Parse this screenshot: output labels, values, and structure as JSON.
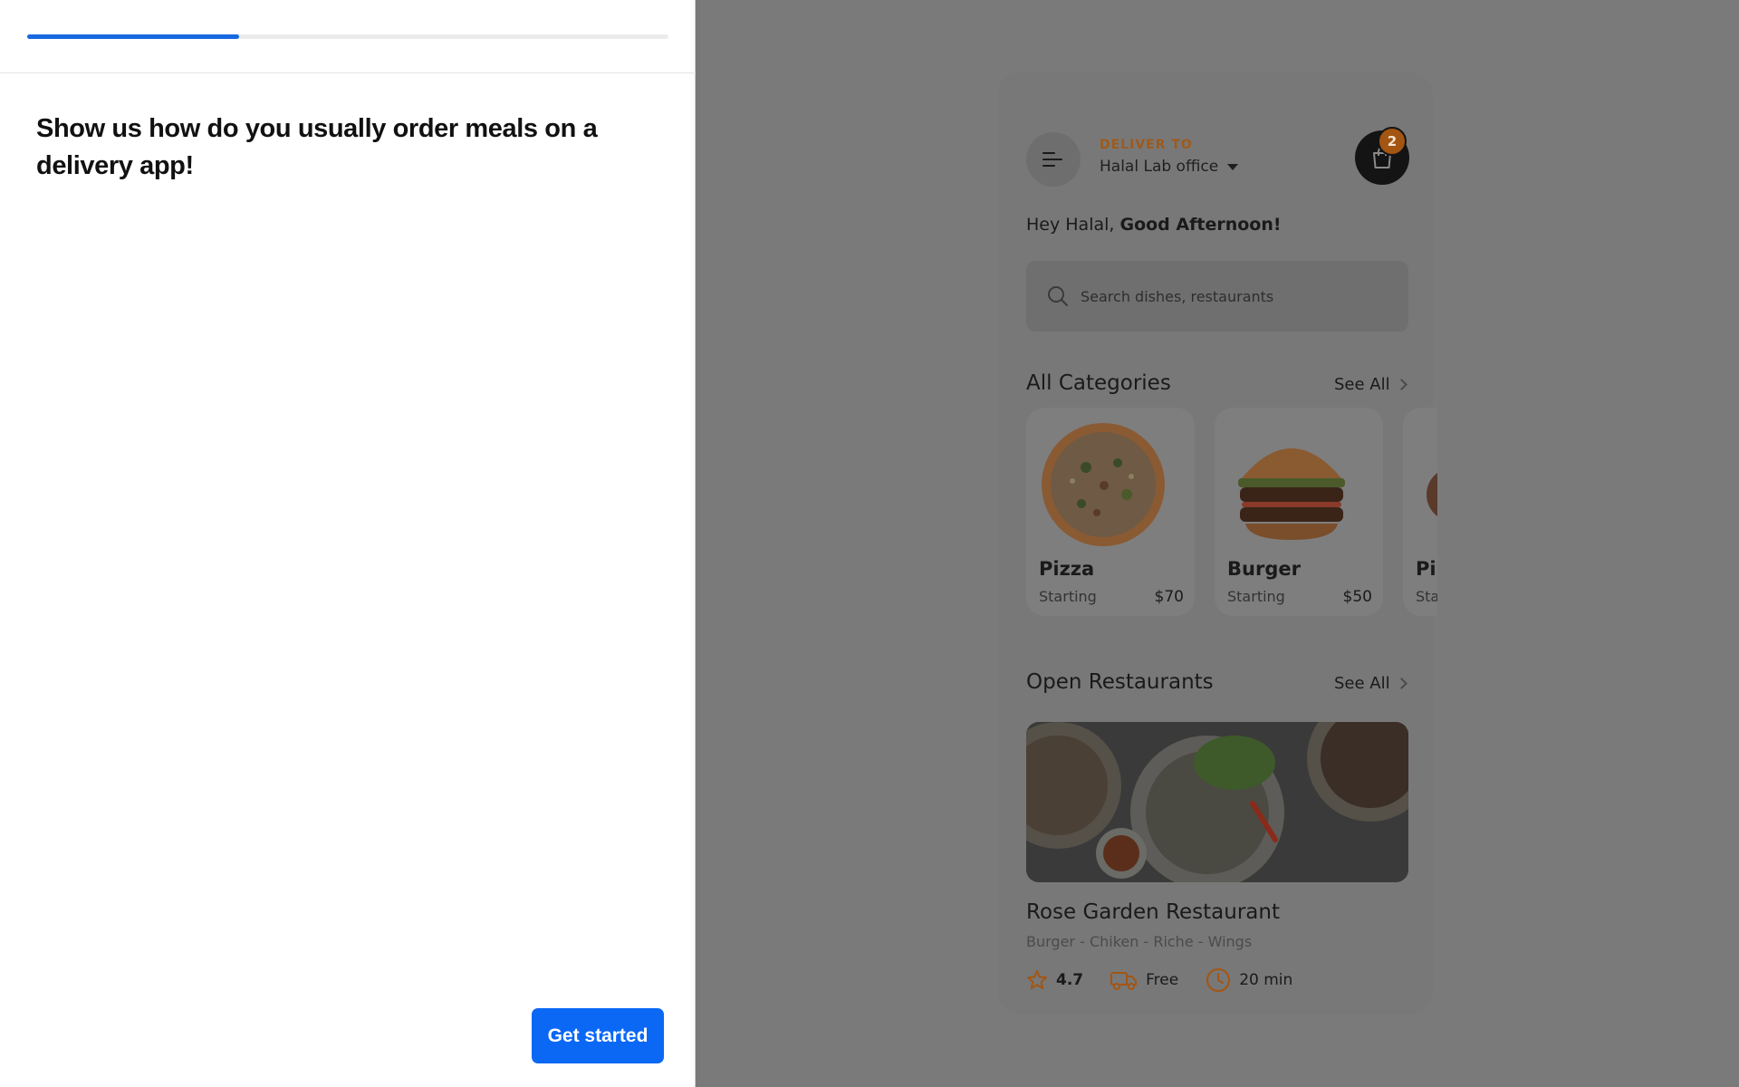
{
  "task": {
    "progress_percent": 33,
    "title": "Show us how do you usually order meals on a delivery app!",
    "primary_button": "Get started"
  },
  "app": {
    "deliver_label": "DELIVER TO",
    "deliver_value": "Halal Lab office",
    "cart_count": "2",
    "greeting_prefix": "Hey Halal, ",
    "greeting_bold": "Good Afternoon!",
    "search_placeholder": "Search dishes, restaurants",
    "categories_title": "All Categories",
    "see_all": "See All",
    "categories": [
      {
        "name": "Pizza",
        "starting": "Starting",
        "price": "$70"
      },
      {
        "name": "Burger",
        "starting": "Starting",
        "price": "$50"
      },
      {
        "name": "Pi",
        "starting": "Sta",
        "price": ""
      }
    ],
    "restaurants_title": "Open Restaurants",
    "restaurant": {
      "name": "Rose Garden Restaurant",
      "tags": "Burger - Chiken - Riche - Wings",
      "rating": "4.7",
      "delivery": "Free",
      "time": "20 min"
    }
  },
  "colors": {
    "accent_blue": "#0b68f5",
    "progress_blue": "#1769e0",
    "brand_orange": "#a35512"
  }
}
